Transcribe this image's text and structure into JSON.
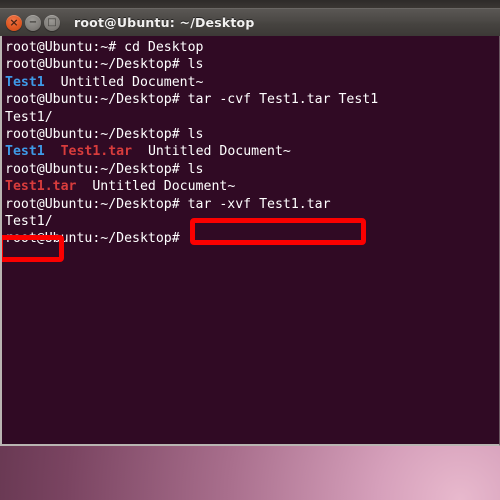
{
  "window": {
    "title": "root@Ubuntu: ~/Desktop",
    "buttons": {
      "close_label": "×",
      "minimize_label": "−",
      "maximize_label": "□",
      "close_name": "close",
      "minimize_name": "minimize",
      "maximize_name": "maximize"
    },
    "colors": {
      "terminal_background": "#300a24",
      "titlebar": "#4b4845",
      "prompt_text": "#ffffff",
      "directory_text": "#3e9ae8",
      "archive_text": "#d83c3c",
      "annotation": "#fb0000"
    }
  },
  "terminal": {
    "lines": [
      {
        "segments": [
          {
            "text": "root@Ubuntu:~# cd Desktop",
            "color": "white"
          }
        ]
      },
      {
        "segments": [
          {
            "text": "root@Ubuntu:~/Desktop# ls",
            "color": "white"
          }
        ]
      },
      {
        "segments": [
          {
            "text": "Test1",
            "color": "blue"
          },
          {
            "text": "  Untitled Document~",
            "color": "white"
          }
        ]
      },
      {
        "segments": [
          {
            "text": "root@Ubuntu:~/Desktop# tar -cvf Test1.tar Test1",
            "color": "white"
          }
        ]
      },
      {
        "segments": [
          {
            "text": "Test1/",
            "color": "white"
          }
        ]
      },
      {
        "segments": [
          {
            "text": "root@Ubuntu:~/Desktop# ls",
            "color": "white"
          }
        ]
      },
      {
        "segments": [
          {
            "text": "Test1",
            "color": "blue"
          },
          {
            "text": "  ",
            "color": "white"
          },
          {
            "text": "Test1.tar",
            "color": "red"
          },
          {
            "text": "  Untitled Document~",
            "color": "white"
          }
        ]
      },
      {
        "segments": [
          {
            "text": "root@Ubuntu:~/Desktop# ls",
            "color": "white"
          }
        ]
      },
      {
        "segments": [
          {
            "text": "Test1.tar",
            "color": "red"
          },
          {
            "text": "  Untitled Document~",
            "color": "white"
          }
        ]
      },
      {
        "segments": [
          {
            "text": "root@Ubuntu:~/Desktop# tar -xvf Test1.tar",
            "color": "white"
          }
        ]
      },
      {
        "segments": [
          {
            "text": "Test1/",
            "color": "white"
          }
        ]
      },
      {
        "segments": [
          {
            "text": "root@Ubuntu:~/Desktop#",
            "color": "white"
          }
        ]
      }
    ]
  },
  "annotations": [
    {
      "id": "annot-cmd",
      "label": "extract-command-highlight",
      "target_text": "tar -xvf Test1.tar"
    },
    {
      "id": "annot-out",
      "label": "extract-output-highlight",
      "target_text": "Test1/"
    }
  ]
}
